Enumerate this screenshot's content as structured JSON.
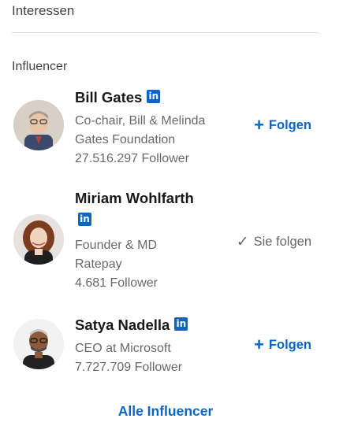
{
  "section": {
    "title": "Interessen"
  },
  "subsection": {
    "title": "Influencer"
  },
  "influencers": [
    {
      "name": "Bill Gates",
      "description_line1": "Co-chair, Bill & Melinda",
      "description_line2": "Gates Foundation",
      "followers": "27.516.297 Follower",
      "action_label": "Folgen",
      "action_icon": "plus-icon",
      "badge": "in"
    },
    {
      "name": "Miriam Wohlfarth",
      "description_line1": "Founder & MD",
      "description_line2": "Ratepay",
      "followers": "4.681 Follower",
      "action_label": "Sie folgen",
      "action_icon": "check-icon",
      "badge": "in"
    },
    {
      "name": "Satya Nadella",
      "description_line1": "CEO at Microsoft",
      "followers": "7.727.709 Follower",
      "action_label": "Folgen",
      "action_icon": "plus-icon",
      "badge": "in"
    }
  ],
  "footer": {
    "all_link": "Alle Influencer"
  },
  "colors": {
    "accent": "#0a66c2",
    "text": "#191919",
    "muted": "#666666",
    "divider": "#d9d9d9"
  }
}
